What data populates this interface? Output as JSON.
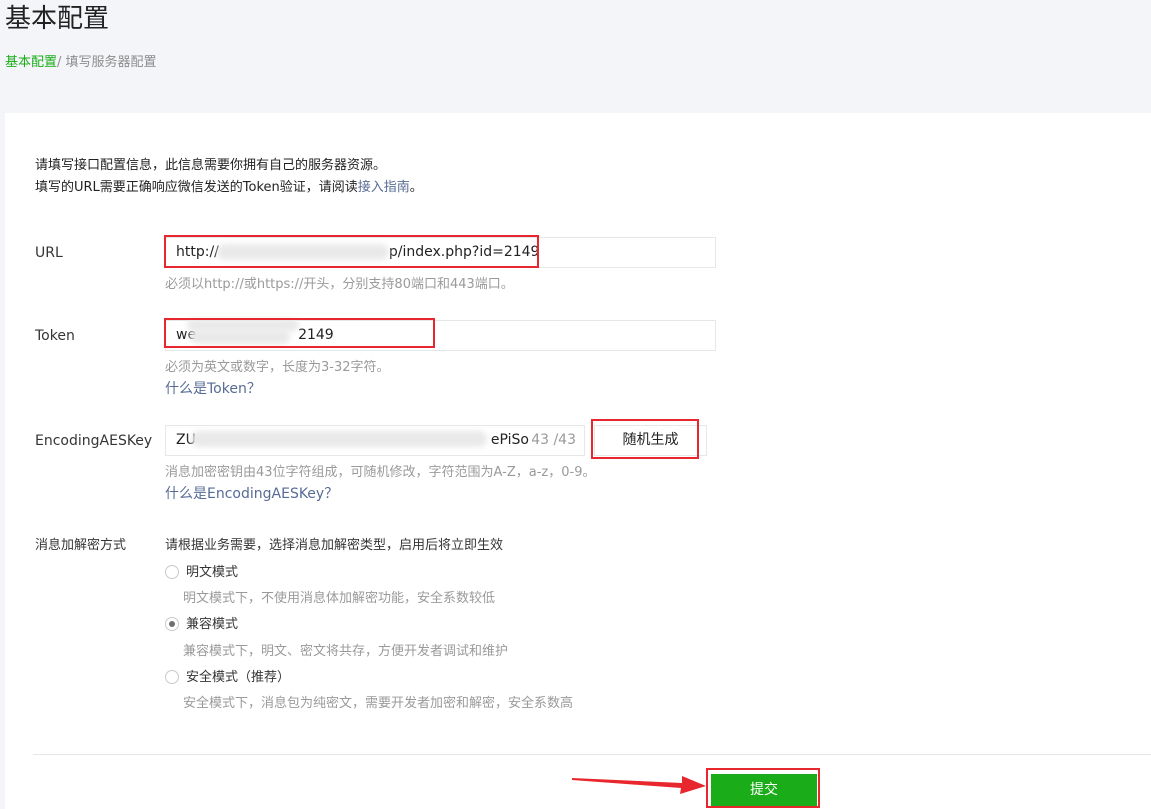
{
  "header": {
    "title": "基本配置"
  },
  "breadcrumb": {
    "root": "基本配置",
    "separator": "/ ",
    "current": "填写服务器配置"
  },
  "intro": {
    "line1": "请填写接口配置信息，此信息需要你拥有自己的服务器资源。",
    "line2_prefix": "填写的URL需要正确响应微信发送的Token验证，请阅读",
    "line2_link": "接入指南",
    "line2_suffix": "。"
  },
  "url": {
    "label": "URL",
    "value_prefix": "http://",
    "value_suffix": "p/index.php?id=2149",
    "hint": "必须以http://或https://开头，分别支持80端口和443端口。"
  },
  "token": {
    "label": "Token",
    "value_prefix": "we",
    "value_suffix": "2149",
    "hint": "必须为英文或数字，长度为3-32字符。",
    "help_link": "什么是Token？"
  },
  "aes": {
    "label": "EncodingAESKey",
    "value_prefix": "ZU",
    "value_suffix": "ePiSo(",
    "counter": "43 /43",
    "generate_button": "随机生成",
    "hint": "消息加密密钥由43位字符组成，可随机修改，字符范围为A-Z，a-z，0-9。",
    "help_link": "什么是EncodingAESKey？"
  },
  "encryption": {
    "label": "消息加解密方式",
    "intro": "请根据业务需要，选择消息加解密类型，启用后将立即生效",
    "options": [
      {
        "label": "明文模式",
        "desc": "明文模式下，不使用消息体加解密功能，安全系数较低",
        "checked": false
      },
      {
        "label": "兼容模式",
        "desc": "兼容模式下，明文、密文将共存，方便开发者调试和维护",
        "checked": true
      },
      {
        "label": "安全模式（推荐）",
        "desc": "安全模式下，消息包为纯密文，需要开发者加密和解密，安全系数高",
        "checked": false
      }
    ]
  },
  "actions": {
    "submit": "提交"
  },
  "colors": {
    "accent": "#1aad19",
    "link": "#576b95",
    "annotation": "#e8262d"
  }
}
